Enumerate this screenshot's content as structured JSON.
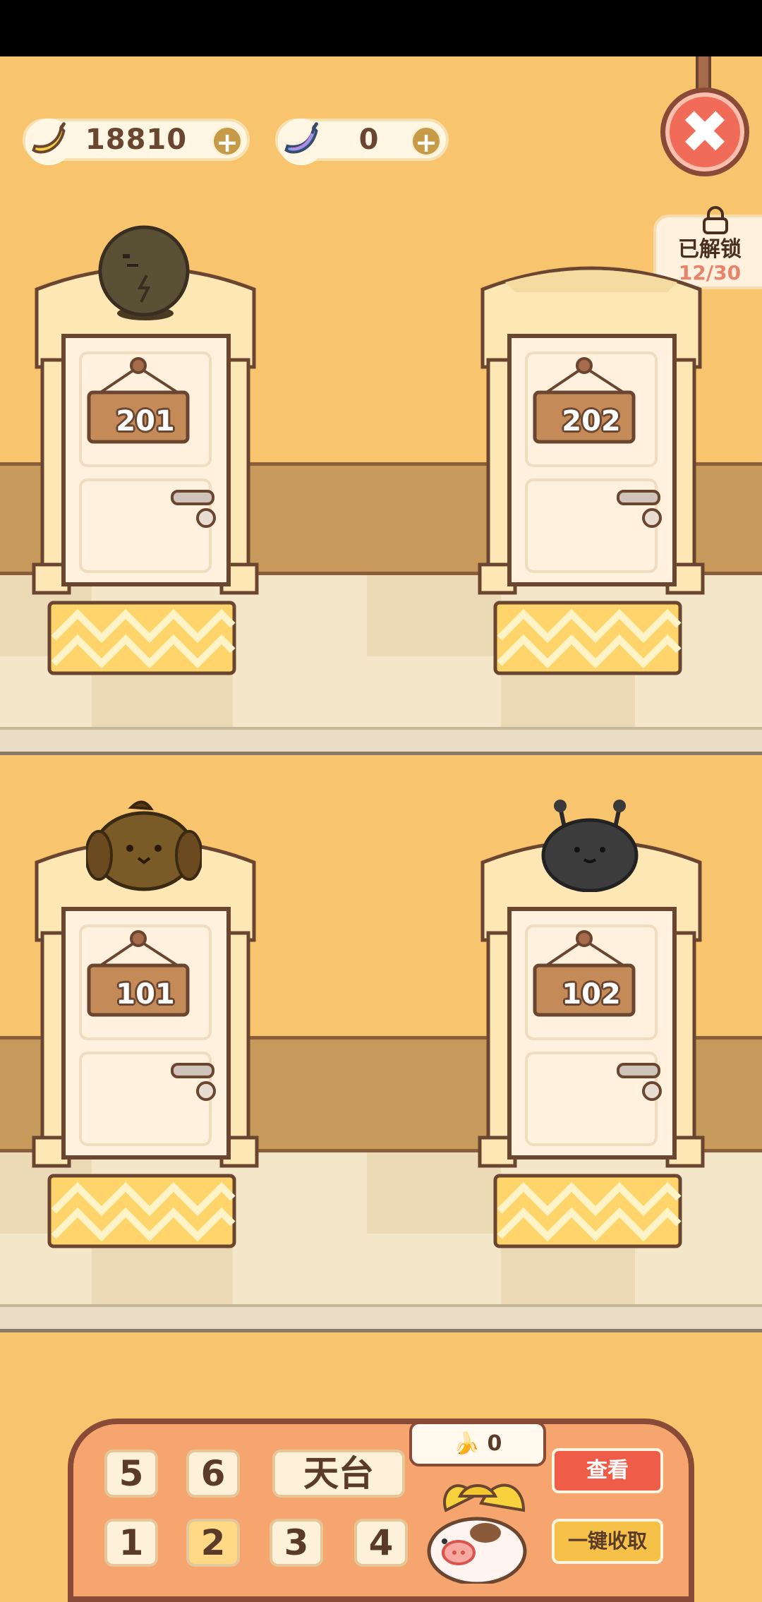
{
  "currency": {
    "banana": {
      "amount": "18810",
      "icon": "banana-icon"
    },
    "blue_banana": {
      "amount": "0",
      "icon": "blue-banana-icon"
    },
    "add_symbol": "+"
  },
  "close": {
    "symbol": "✖"
  },
  "unlock": {
    "label": "已解锁",
    "count": "12/30"
  },
  "rooms": [
    {
      "number": "201",
      "occupant": "gray-bun-character"
    },
    {
      "number": "202",
      "occupant": ""
    },
    {
      "number": "101",
      "occupant": "brown-puppy-character"
    },
    {
      "number": "102",
      "occupant": "black-blob-character"
    }
  ],
  "panel": {
    "floors_top": [
      "5",
      "6",
      "天台"
    ],
    "floors_bottom": [
      "1",
      "2",
      "3",
      "4"
    ],
    "active_floor": "2",
    "collected": "0",
    "view_label": "查看",
    "collect_all_label": "一键收取"
  },
  "colors": {
    "wall": "#f8c46e",
    "panel": "#f7a56e",
    "close": "#f16c58",
    "view_button": "#ef5c48",
    "collect_button": "#f6c149"
  }
}
